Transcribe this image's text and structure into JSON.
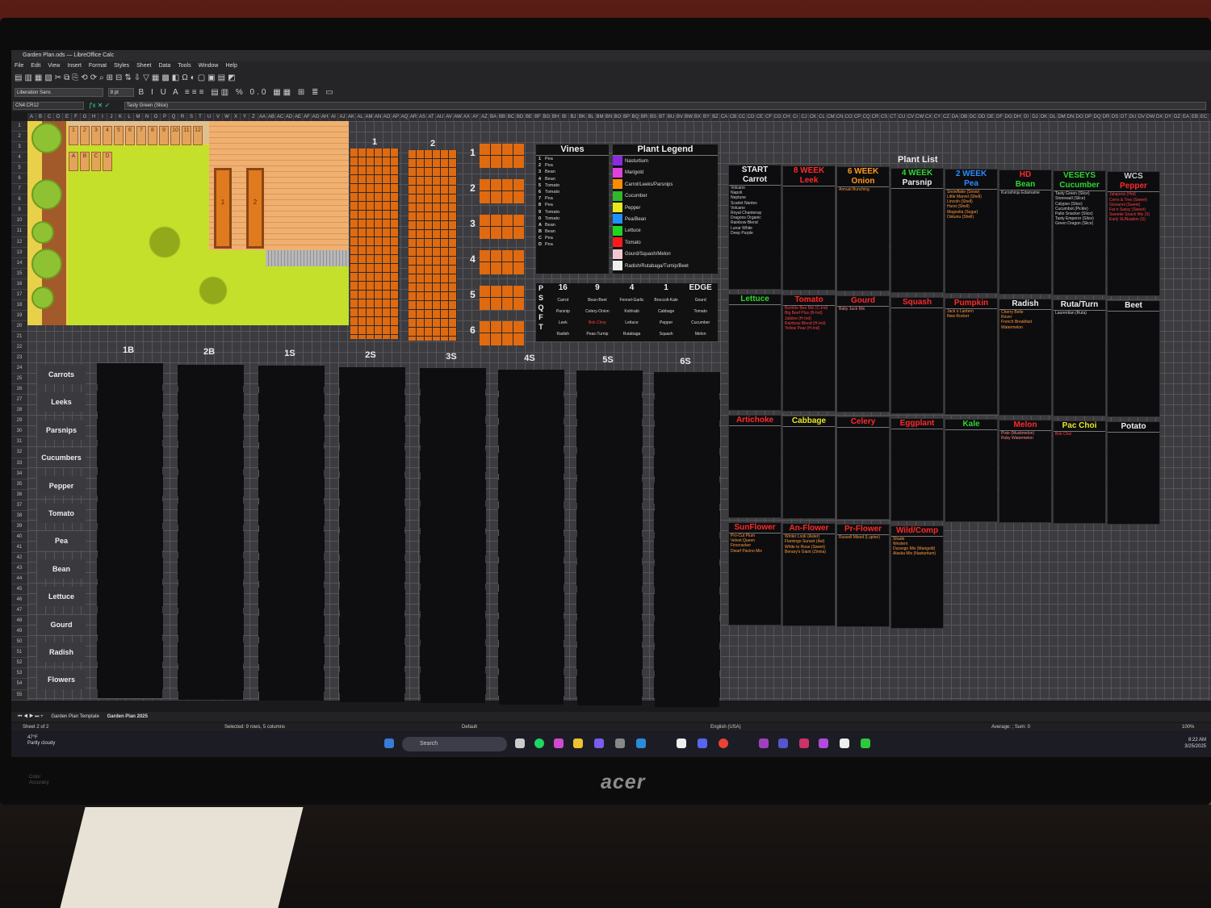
{
  "window": {
    "title": "Garden Plan.ods — LibreOffice Calc"
  },
  "menu": [
    "File",
    "Edit",
    "View",
    "Insert",
    "Format",
    "Styles",
    "Sheet",
    "Data",
    "Tools",
    "Window",
    "Help"
  ],
  "toolbar": {
    "font_name": "Liberation Sans",
    "font_size": "8 pt"
  },
  "formula_bar": {
    "cell_ref": "CN4:CR12",
    "content": "Tasty Green (Slice)"
  },
  "map": {
    "top_labels": [
      "1",
      "2",
      "3",
      "4",
      "5",
      "6",
      "7",
      "8",
      "9",
      "10",
      "11",
      "12",
      "A",
      "B",
      "C",
      "D"
    ],
    "bed_labels": [
      "1",
      "2"
    ]
  },
  "tall_beds": {
    "labels": [
      "1",
      "2"
    ]
  },
  "small_beds": {
    "labels": [
      "1",
      "2",
      "3",
      "4",
      "5",
      "6"
    ]
  },
  "vines": {
    "title": "Vines",
    "rows": [
      {
        "k": "1",
        "v": "Pea"
      },
      {
        "k": "2",
        "v": "Pea"
      },
      {
        "k": "3",
        "v": "Bean"
      },
      {
        "k": "4",
        "v": "Bean"
      },
      {
        "k": "5",
        "v": "Tomato"
      },
      {
        "k": "6",
        "v": "Tomato"
      },
      {
        "k": "7",
        "v": "Pea"
      },
      {
        "k": "8",
        "v": "Pea"
      },
      {
        "k": "9",
        "v": "Tomato"
      },
      {
        "k": "0",
        "v": "Tomato"
      },
      {
        "k": "A",
        "v": "Bean"
      },
      {
        "k": "B",
        "v": "Bean"
      },
      {
        "k": "C",
        "v": "Pea"
      },
      {
        "k": "D",
        "v": "Pea"
      }
    ]
  },
  "legend": {
    "title": "Plant Legend",
    "items": [
      {
        "label": "Nasturtium",
        "color": "#8a2be2"
      },
      {
        "label": "Marigold",
        "color": "#e040e0"
      },
      {
        "label": "Carrot/Leeks/Parsnips",
        "color": "#ff8c00"
      },
      {
        "label": "Cucumber",
        "color": "#2eb82e"
      },
      {
        "label": "Pepper",
        "color": "#e8e820"
      },
      {
        "label": "Pea/Bean",
        "color": "#1e90ff"
      },
      {
        "label": "Lettuce",
        "color": "#1fd61f"
      },
      {
        "label": "Tomato",
        "color": "#ff1a1a"
      },
      {
        "label": "Gourd/Squash/Melon",
        "color": "#f2c6cf"
      },
      {
        "label": "Radish/Rutabaga/Turnip/Beet",
        "color": "#eeeeee"
      }
    ]
  },
  "psqft": {
    "side": [
      "P",
      "S",
      "Q",
      "F",
      "T"
    ],
    "headers": [
      "16",
      "9",
      "4",
      "1",
      "EDGE"
    ],
    "rows": [
      [
        "Carrot",
        "Bean-Beet",
        "Fennel-Garlic",
        "Broccoli-Kale",
        "Gourd"
      ],
      [
        "Parsnip",
        "Celery-Onion",
        "Kohlrabi",
        "Cabbage",
        "Tomato"
      ],
      [
        "Leek",
        "Bok Choy",
        "Lettuce",
        "Pepper",
        "Cucumber"
      ],
      [
        "Radish",
        "Peas-Turnip",
        "Rutabaga",
        "Squash",
        "Melon"
      ]
    ]
  },
  "planner": {
    "columns": [
      "1B",
      "2B",
      "1S",
      "2S",
      "3S",
      "4S",
      "5S",
      "6S"
    ],
    "rows": [
      "Carrots",
      "Leeks",
      "Parsnips",
      "Cucumbers",
      "Pepper",
      "Tomato",
      "Pea",
      "Bean",
      "Lettuce",
      "Gourd",
      "Radish",
      "Flowers"
    ]
  },
  "plant_list": {
    "title": "Plant List",
    "groups": [
      [
        {
          "h1": "START",
          "h2": "Carrot",
          "c1": "#eeeeee",
          "c2": "#eeeeee",
          "items": [
            "Volcano",
            "Napoli",
            "Neptune",
            "Scarlet Nantes",
            "Volcano",
            "Royal Chantenay",
            "Dragons Organic",
            "Rainbow Blend",
            "Lunar White",
            "Deep Purple"
          ],
          "ic": "#d0d0d0"
        },
        {
          "h1": "8 WEEK",
          "h2": "Leek",
          "c1": "#ff2a2a",
          "c2": "#ff2a2a",
          "items": [],
          "ic": "#ff9a3a"
        },
        {
          "h1": "6 WEEK",
          "h2": "Onion",
          "c1": "#ff9a1a",
          "c2": "#ff9a1a",
          "items": [
            "Annual Bunching"
          ],
          "ic": "#ff9a3a"
        },
        {
          "h1": "4 WEEK",
          "h2": "Parsnip",
          "c1": "#2ed82e",
          "c2": "#eeeeee",
          "items": [],
          "ic": "#d0d0d0"
        },
        {
          "h1": "2 WEEK",
          "h2": "Pea",
          "c1": "#2a8cff",
          "c2": "#2a8cff",
          "items": [
            "Snowflake (Snow)",
            "Little Marvel (Shell)",
            "Lincoln (Shell)",
            "Hurst (Shell)",
            "Magnolia (Sugar)",
            "Oskunu (Shell)"
          ],
          "ic": "#ff9a3a"
        },
        {
          "h1": "HD",
          "h2": "Bean",
          "c1": "#ff2a2a",
          "c2": "#2ed82e",
          "items": [
            "Kuroshinju Edamame"
          ],
          "ic": "#d0d0d0"
        },
        {
          "h1": "VESEYS",
          "h2": "Cucumber",
          "c1": "#2ed82e",
          "c2": "#2ed82e",
          "items": [
            "Tasty Green (Slice)",
            "Stonewall (Slice)",
            "Calypso (Slice)",
            "Cucumbot (Pickle)",
            "Patio Snacker (Slice)",
            "Tasty Emperor (Slice)",
            "Green Dragon (Slice)"
          ],
          "ic": "#d0d0d0"
        },
        {
          "h1": "WCS",
          "h2": "Pepper",
          "c1": "#cccccc",
          "c2": "#ff2a2a",
          "items": [
            "Jalapeno (Hot)",
            "Cerro & Tres (Sweet)",
            "Giovanni (Sweet)",
            "Fat n Sassy (Sweet)",
            "Sweetie Snack Mix (S)",
            "Early SUNsation (S)"
          ],
          "ic": "#ff4040"
        }
      ],
      [
        {
          "h1": "Lettuce",
          "c1": "#2ed82e",
          "items": [],
          "ic": "#d0d0d0"
        },
        {
          "h1": "Tomato",
          "c1": "#ff2a2a",
          "items": [
            "Bumble Bee Mix (C-Ind)",
            "Big Beef Plus (B-Ind)",
            "Jubilee (H-Ind)",
            "Rainbow Blend (H-Ind)",
            "Yellow Pear (H-Ind)"
          ],
          "ic": "#ff4040"
        },
        {
          "h1": "Gourd",
          "c1": "#ff2a2a",
          "items": [
            "Baby Jack Mix"
          ],
          "ic": "#ff8a8a"
        },
        {
          "h1": "Squash",
          "c1": "#ff2a2a",
          "items": [],
          "ic": "#d0d0d0"
        },
        {
          "h1": "Pumpkin",
          "c1": "#ff2a2a",
          "items": [
            "Jack o Lantern",
            "New Rocket"
          ],
          "ic": "#ff9a3a"
        },
        {
          "h1": "Radish",
          "c1": "#eeeeee",
          "items": [
            "Cherry Belle",
            "Rover",
            "French Breakfast",
            "Watermelon"
          ],
          "ic": "#ff9a3a"
        },
        {
          "h1": "Ruta/Turn",
          "c1": "#eeeeee",
          "items": [
            "Laurentian (Ruta)"
          ],
          "ic": "#d0d0d0"
        },
        {
          "h1": "Beet",
          "c1": "#eeeeee",
          "items": [],
          "ic": "#d0d0d0"
        }
      ],
      [
        {
          "h1": "Artichoke",
          "c1": "#ff2a2a",
          "items": [],
          "ic": "#d0d0d0"
        },
        {
          "h1": "Cabbage",
          "c1": "#e8e820",
          "items": [],
          "ic": "#d0d0d0"
        },
        {
          "h1": "Celery",
          "c1": "#ff2a2a",
          "items": [],
          "ic": "#d0d0d0"
        },
        {
          "h1": "Eggplant",
          "c1": "#ff2a2a",
          "items": [],
          "ic": "#d0d0d0"
        },
        {
          "h1": "Kale",
          "c1": "#2ed82e",
          "items": [],
          "ic": "#d0d0d0"
        },
        {
          "h1": "Melon",
          "c1": "#ff2a2a",
          "items": [
            "Pixie (Muskmelon)",
            "Ruby Watermelon"
          ],
          "ic": "#ff8a8a"
        },
        {
          "h1": "Pac Choi",
          "c1": "#e8e820",
          "items": [
            "Bok Choi"
          ],
          "ic": "#ff4040"
        },
        {
          "h1": "Potato",
          "c1": "#eeeeee",
          "items": [],
          "ic": "#d0d0d0"
        }
      ],
      [
        {
          "h1": "SunFlower",
          "c1": "#ff2a2a",
          "items": [
            "Pro-Cut Plum",
            "Velvet Queen",
            "Firecracker",
            "Dwarf Pacino Mix"
          ],
          "ic": "#ff9a3a"
        },
        {
          "h1": "An-Flower",
          "c1": "#ff2a2a",
          "items": [
            "Winter Look (Aster)",
            "Flamingo Sunset (Ast)",
            "White to Rose (Sweet)",
            "Benary's Giant (Zinnia)"
          ],
          "ic": "#ff9a3a"
        },
        {
          "h1": "Pr-Flower",
          "c1": "#ff2a2a",
          "items": [
            "Russell Mixed (Lupine)"
          ],
          "ic": "#ff9a3a"
        },
        {
          "h1": "Wild/Comp",
          "c1": "#ff2a2a",
          "items": [
            "Shade",
            "Western",
            "Durango Mix (Marigold)",
            "Alaska Mix (Nasturtium)"
          ],
          "ic": "#ff9a3a"
        }
      ]
    ]
  },
  "sheet_tabs": {
    "tabs": [
      "Garden Plan Template",
      "Garden Plan 2025"
    ],
    "position": "Sheet 2 of 2"
  },
  "status": {
    "selection": "Selected: 9 rows, 5 columns",
    "style": "Default",
    "language": "English (USA)",
    "calc": "Average: ; Sum: 0",
    "zoom": "100%"
  },
  "taskbar": {
    "temp": "47°F",
    "weather": "Partly cloudy",
    "search": "Search",
    "time": "8:22 AM",
    "date": "3/25/2025"
  },
  "monitor": {
    "brand": "acer",
    "sticker": "Color Accuracy"
  }
}
